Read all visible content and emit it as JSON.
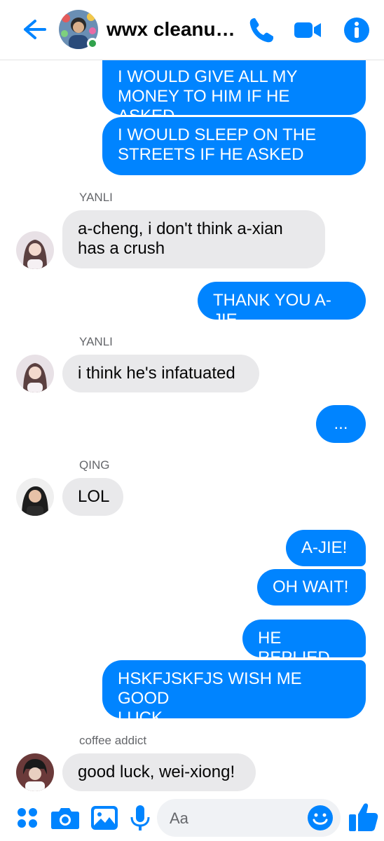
{
  "header": {
    "title": "wwx cleanup s...",
    "back_icon": "back-arrow-icon",
    "call_icon": "phone-icon",
    "video_icon": "video-camera-icon",
    "info_icon": "info-icon"
  },
  "messages": [
    {
      "type": "out",
      "text_lines": [
        "I WOULD GIVE ALL MY",
        "MONEY TO HIM IF HE ASKED"
      ]
    },
    {
      "type": "out",
      "text_lines": [
        "I WOULD SLEEP ON THE",
        "STREETS IF HE ASKED"
      ]
    },
    {
      "type": "sender",
      "text": "YANLI"
    },
    {
      "type": "in",
      "text_lines": [
        "a-cheng, i don't think a-xian",
        "has a crush"
      ]
    },
    {
      "type": "out",
      "text_lines": [
        "THANK YOU A-JIE"
      ]
    },
    {
      "type": "sender",
      "text": "YANLI"
    },
    {
      "type": "in",
      "text_lines": [
        "i think he's infatuated"
      ]
    },
    {
      "type": "out",
      "text_lines": [
        "..."
      ]
    },
    {
      "type": "sender",
      "text": "QING"
    },
    {
      "type": "in",
      "text_lines": [
        "LOL"
      ]
    },
    {
      "type": "out",
      "text_lines": [
        "A-JIE!"
      ]
    },
    {
      "type": "out",
      "text_lines": [
        "OH WAIT!"
      ]
    },
    {
      "type": "out",
      "text_lines": [
        "HE REPLIED"
      ]
    },
    {
      "type": "out",
      "text_lines": [
        "HSKFJSKFJS WISH ME GOOD",
        "LUCK"
      ]
    },
    {
      "type": "sender",
      "text": "coffee addict"
    },
    {
      "type": "in",
      "text_lines": [
        "good luck, wei-xiong!"
      ]
    }
  ],
  "composer": {
    "placeholder": "Aa",
    "icons": [
      "apps-icon",
      "camera-icon",
      "image-icon",
      "microphone-icon",
      "emoji-icon",
      "thumbs-up-icon"
    ]
  },
  "colors": {
    "accent": "#0084ff",
    "incoming_bubble": "#e9e9eb",
    "online": "#31a24c"
  }
}
